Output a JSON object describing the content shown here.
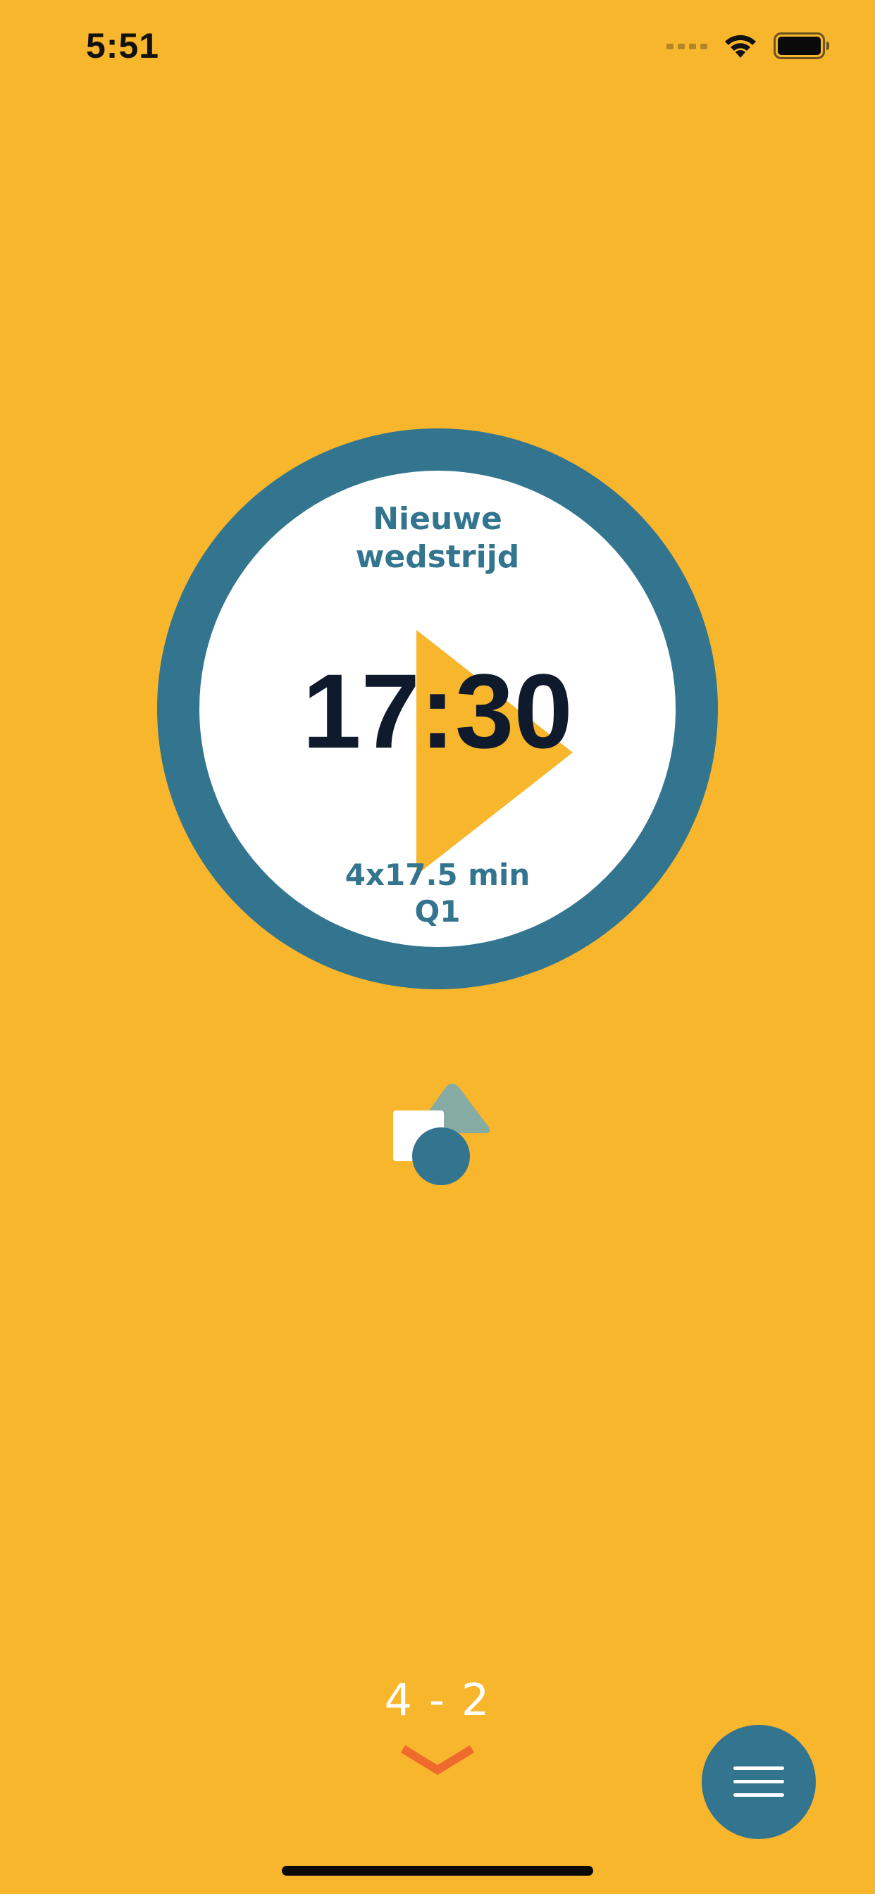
{
  "status_bar": {
    "time": "5:51"
  },
  "timer": {
    "title_line1": "Nieuwe",
    "title_line2": "wedstrijd",
    "time": "17:30",
    "format": "4x17.5 min",
    "period": "Q1"
  },
  "score": {
    "text": "4 - 2"
  },
  "icons": {
    "play": "play-icon",
    "logo": "shapes-logo-icon",
    "chevron": "chevron-down-icon",
    "menu": "hamburger-menu-icon",
    "wifi": "wifi-icon",
    "battery": "battery-icon",
    "signal": "cellular-signal-icon"
  },
  "colors": {
    "background": "#F8B62D",
    "accent_blue": "#33748F",
    "timer_text": "#0F1A2C",
    "chevron": "#F06A2E",
    "logo_triangle": "#86ABA3",
    "white": "#FFFFFF"
  }
}
